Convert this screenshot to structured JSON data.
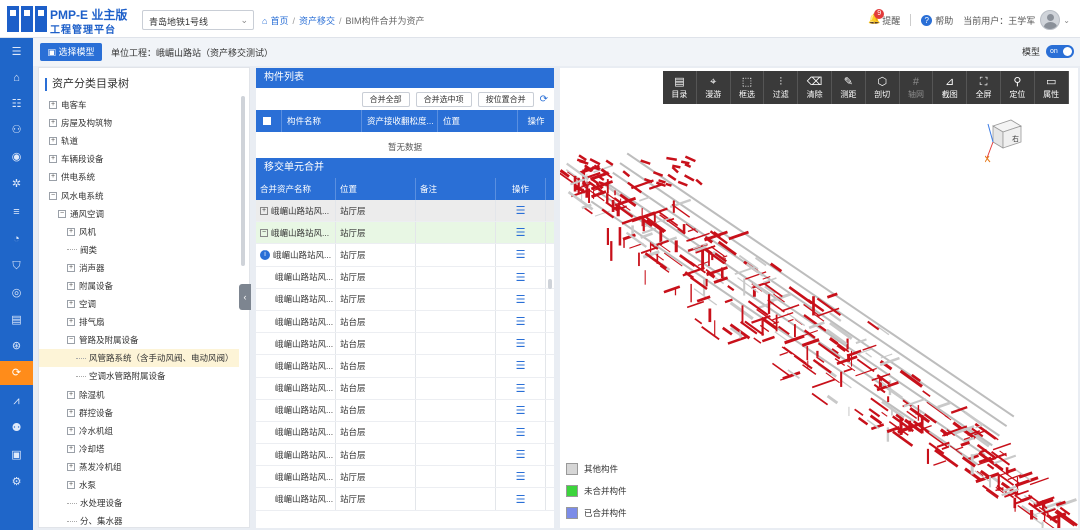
{
  "header": {
    "logo_title": "PMP-E 业主版",
    "logo_sub": "工程管理平台",
    "line_select": "青岛地铁1号线",
    "breadcrumb": [
      "首页",
      "资产移交",
      "BIM构件合并为资产"
    ],
    "notice_count": "9",
    "notice_label": "提醒",
    "help_label": "帮助",
    "current_user": "当前用户：王学军"
  },
  "colors": {
    "primary": "#2a6fd6",
    "active_nav": "#ff8c1a",
    "model_red": "#c8101a",
    "toolbar_dark": "#3a3a3a"
  },
  "leftnav": [
    "menu-toggle-icon",
    "home-icon",
    "org-chart-icon",
    "flow-icon",
    "settings-circle-icon",
    "gear-icon",
    "sliders-icon",
    "pie-chart-icon",
    "shield-icon",
    "target-icon",
    "document-icon",
    "coin-icon",
    "asset-transfer-icon",
    "line-chart-icon",
    "people-icon",
    "image-icon",
    "cog-icon"
  ],
  "subbar": {
    "select_model": "选择模型",
    "unit_label": "单位工程：峨嵋山路站（资产移交测试）",
    "model_label": "模型",
    "toggle": "on"
  },
  "tree": {
    "title": "资产分类目录树",
    "items": [
      {
        "label": "电客车",
        "level": 0,
        "toggle": "+"
      },
      {
        "label": "房屋及构筑物",
        "level": 0,
        "toggle": "+"
      },
      {
        "label": "轨道",
        "level": 0,
        "toggle": "+"
      },
      {
        "label": "车辆段设备",
        "level": 0,
        "toggle": "+"
      },
      {
        "label": "供电系统",
        "level": 0,
        "toggle": "+"
      },
      {
        "label": "风水电系统",
        "level": 0,
        "toggle": "−"
      },
      {
        "label": "通风空调",
        "level": 1,
        "toggle": "−"
      },
      {
        "label": "风机",
        "level": 2,
        "toggle": "+"
      },
      {
        "label": "阀类",
        "level": 2,
        "toggle": ""
      },
      {
        "label": "消声器",
        "level": 2,
        "toggle": "+"
      },
      {
        "label": "附属设备",
        "level": 2,
        "toggle": "+"
      },
      {
        "label": "空调",
        "level": 2,
        "toggle": "+"
      },
      {
        "label": "排气扇",
        "level": 2,
        "toggle": "+"
      },
      {
        "label": "管路及附属设备",
        "level": 2,
        "toggle": "−"
      },
      {
        "label": "风管路系统（含手动风阀、电动风阀）",
        "level": 3,
        "toggle": "",
        "selected": true
      },
      {
        "label": "空调水管路附属设备",
        "level": 3,
        "toggle": ""
      },
      {
        "label": "除湿机",
        "level": 2,
        "toggle": "+"
      },
      {
        "label": "群控设备",
        "level": 2,
        "toggle": "+"
      },
      {
        "label": "冷水机组",
        "level": 2,
        "toggle": "+"
      },
      {
        "label": "冷却塔",
        "level": 2,
        "toggle": "+"
      },
      {
        "label": "蒸发冷机组",
        "level": 2,
        "toggle": "+"
      },
      {
        "label": "水泵",
        "level": 2,
        "toggle": "+"
      },
      {
        "label": "水处理设备",
        "level": 2,
        "toggle": ""
      },
      {
        "label": "分、集水器",
        "level": 2,
        "toggle": ""
      }
    ]
  },
  "component_list": {
    "title": "构件列表",
    "buttons": [
      "合并全部",
      "合并选中项",
      "按位置合并"
    ],
    "columns": [
      "",
      "构件名称",
      "资产接收翻松度...",
      "位置",
      "操作"
    ],
    "empty": "暂无数据"
  },
  "merge_units": {
    "title": "移交单元合并",
    "columns": [
      "合并资产名称",
      "位置",
      "备注",
      "操作"
    ],
    "rows": [
      {
        "name": "峨嵋山路站风...",
        "location": "站厅层",
        "note": "",
        "style": "gray",
        "marker": "+"
      },
      {
        "name": "峨嵋山路站风...",
        "location": "站厅层",
        "note": "",
        "style": "green",
        "marker": "−"
      },
      {
        "name": "峨嵋山路站风...",
        "location": "站厅层",
        "note": "",
        "style": "",
        "marker": "badge"
      },
      {
        "name": "峨嵋山路站风...",
        "location": "站厅层",
        "note": "",
        "style": "",
        "marker": ""
      },
      {
        "name": "峨嵋山路站风...",
        "location": "站厅层",
        "note": "",
        "style": "",
        "marker": ""
      },
      {
        "name": "峨嵋山路站风...",
        "location": "站台层",
        "note": "",
        "style": "",
        "marker": ""
      },
      {
        "name": "峨嵋山路站风...",
        "location": "站台层",
        "note": "",
        "style": "",
        "marker": ""
      },
      {
        "name": "峨嵋山路站风...",
        "location": "站台层",
        "note": "",
        "style": "",
        "marker": ""
      },
      {
        "name": "峨嵋山路站风...",
        "location": "站台层",
        "note": "",
        "style": "",
        "marker": ""
      },
      {
        "name": "峨嵋山路站风...",
        "location": "站台层",
        "note": "",
        "style": "",
        "marker": ""
      },
      {
        "name": "峨嵋山路站风...",
        "location": "站台层",
        "note": "",
        "style": "",
        "marker": ""
      },
      {
        "name": "峨嵋山路站风...",
        "location": "站台层",
        "note": "",
        "style": "",
        "marker": ""
      },
      {
        "name": "峨嵋山路站风...",
        "location": "站厅层",
        "note": "",
        "style": "",
        "marker": ""
      },
      {
        "name": "峨嵋山路站风...",
        "location": "站厅层",
        "note": "",
        "style": "",
        "marker": ""
      }
    ]
  },
  "viewer": {
    "tools": [
      {
        "label": "目录",
        "icon": "catalog-icon",
        "glyph": "▤"
      },
      {
        "label": "漫游",
        "icon": "roam-icon",
        "glyph": "⌖"
      },
      {
        "label": "框选",
        "icon": "box-select-icon",
        "glyph": "⬚"
      },
      {
        "label": "过滤",
        "icon": "filter-icon",
        "glyph": "⫶"
      },
      {
        "label": "清除",
        "icon": "clear-icon",
        "glyph": "⌫"
      },
      {
        "label": "测距",
        "icon": "measure-icon",
        "glyph": "✎"
      },
      {
        "label": "剖切",
        "icon": "section-icon",
        "glyph": "⬡"
      },
      {
        "label": "轴网",
        "icon": "grid-icon",
        "glyph": "#",
        "disabled": true
      },
      {
        "label": "截图",
        "icon": "screenshot-icon",
        "glyph": "⊿"
      },
      {
        "label": "全屏",
        "icon": "fullscreen-icon",
        "glyph": "⛶"
      },
      {
        "label": "定位",
        "icon": "locate-icon",
        "glyph": "⚲"
      },
      {
        "label": "属性",
        "icon": "property-icon",
        "glyph": "▭"
      }
    ],
    "cube_label": "右",
    "legend": [
      {
        "label": "其他构件",
        "color": "#d6d6d6"
      },
      {
        "label": "未合并构件",
        "color": "#3cd43c"
      },
      {
        "label": "已合并构件",
        "color": "#7c8ce8"
      }
    ]
  }
}
